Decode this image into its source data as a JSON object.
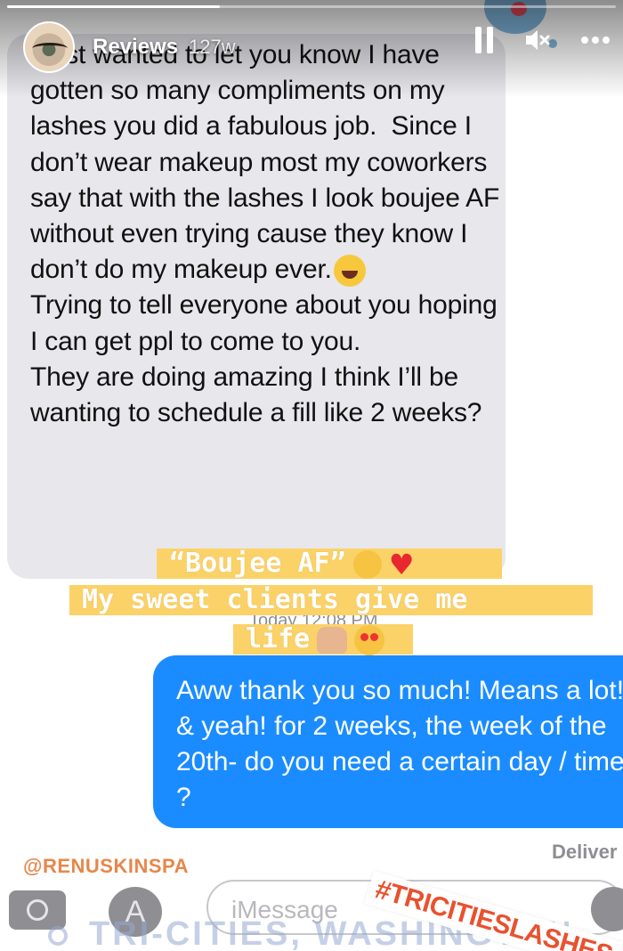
{
  "story": {
    "username": "Reviews",
    "time_ago": "127w",
    "progress": 0.35
  },
  "received_message": {
    "text": "I just wanted to let you know I have gotten so many compliments on my lashes you did a fabulous job.  Since I don’t wear makeup most my coworkers say that with the lashes I look boujee AF without even trying cause they know I don’t do my makeup ever.",
    "text_after_emoji": "\nTrying to tell everyone about you hoping I can get ppl to come to you.\nThey are doing amazing I think I’ll be wanting to schedule a fill like 2 weeks?"
  },
  "stickers": {
    "line1": "“Boujee AF”",
    "line2": "My sweet clients give me",
    "line3": "life"
  },
  "timestamp": "Today 12:08 PM",
  "sent_message": {
    "text": "Aww thank you so much! Means a lot! & yeah! for 2 weeks, the week of the 20th- do you need a certain day / time ?"
  },
  "delivered_label": "Deliver",
  "mention": "@RENUSKINSPA",
  "hashtag": "#TRICITIESLASHES",
  "imessage_placeholder": "iMessage",
  "location": "TRI-CITIES, WASHINGTON",
  "icons": {
    "pause": "pause-icon",
    "mute": "speaker-muted-icon",
    "more": "more-icon",
    "camera": "camera-icon",
    "appstore": "app-store-icon",
    "mic": "microphone-icon",
    "pin": "location-pin-icon"
  }
}
